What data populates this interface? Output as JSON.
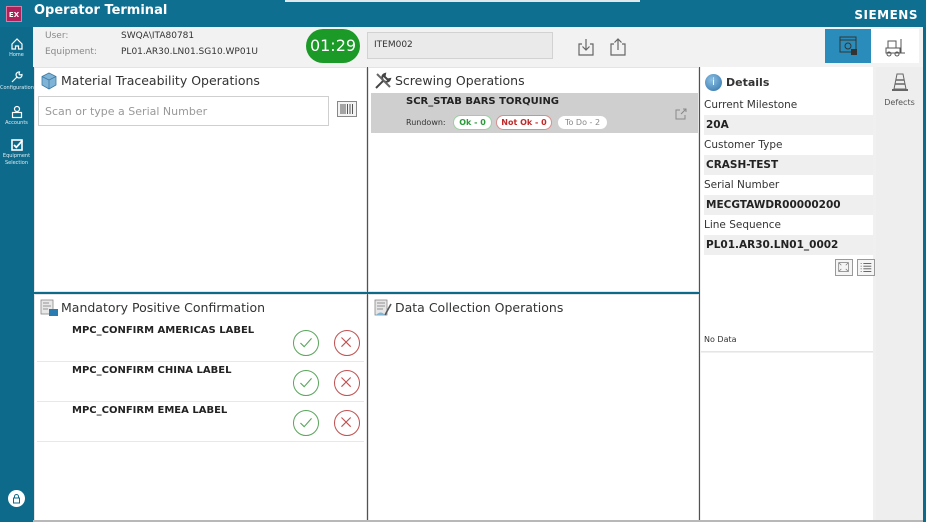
{
  "app": {
    "logo_text": "EX",
    "title": "Operator Terminal",
    "brand": "SIEMENS"
  },
  "nav": {
    "items": [
      {
        "label": "Home",
        "icon": "home-icon"
      },
      {
        "label": "Configuration",
        "icon": "wrench-icon"
      },
      {
        "label": "Accounts",
        "icon": "user-icon"
      },
      {
        "label": "Equipment Selection",
        "icon": "checkbox-icon"
      }
    ],
    "lock_icon": "lock-icon"
  },
  "header": {
    "user_label": "User:",
    "user_value": "SWQA\\ITA80781",
    "equipment_label": "Equipment:",
    "equipment_value": "PL01.AR30.LN01.SG10.WP01U",
    "timer": "01:29",
    "item_value": "ITEM002",
    "timer_color": "#1b9a28",
    "accent_color": "#2a8cba"
  },
  "material": {
    "title": "Material Traceability Operations",
    "serial_placeholder": "Scan or type a Serial Number",
    "serial_value": ""
  },
  "screwing": {
    "title": "Screwing Operations",
    "operations": [
      {
        "name": "SCR_STAB BARS TORQUING",
        "rundown_label": "Rundown:",
        "ok": "Ok - 0",
        "not_ok": "Not Ok - 0",
        "todo": "To Do - 2"
      }
    ]
  },
  "mpc": {
    "title": "Mandatory Positive Confirmation",
    "items": [
      {
        "name": "MPC_CONFIRM AMERICAS LABEL"
      },
      {
        "name": "MPC_CONFIRM CHINA LABEL"
      },
      {
        "name": "MPC_CONFIRM EMEA LABEL"
      }
    ]
  },
  "data_collection": {
    "title": "Data Collection Operations"
  },
  "details": {
    "title": "Details",
    "fields": [
      {
        "label": "Current Milestone",
        "value": "20A"
      },
      {
        "label": "Customer Type",
        "value": "CRASH-TEST"
      },
      {
        "label": "Serial Number",
        "value": "MECGTAWDR00000200"
      },
      {
        "label": "Line Sequence",
        "value": "PL01.AR30.LN01_0002"
      }
    ],
    "no_data": "No Data"
  },
  "defects": {
    "label": "Defects"
  }
}
